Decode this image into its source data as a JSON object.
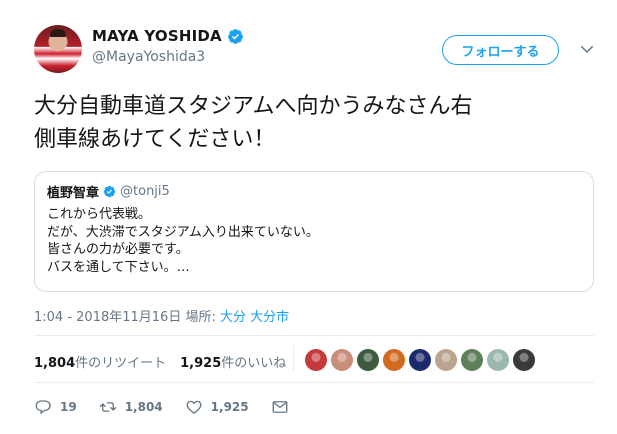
{
  "author": {
    "display_name": "MAYA YOSHIDA",
    "handle": "@MayaYoshida3",
    "verified": true
  },
  "follow_button_label": "フォローする",
  "tweet_text_line1": "大分自動車道スタジアムへ向かうみなさん右",
  "tweet_text_line2": "側車線あけてください！",
  "quoted": {
    "display_name": "植野智章",
    "handle": "@tonji5",
    "lines": [
      "これから代表戦。",
      "だが、大渋滞でスタジアム入り出来ていない。",
      "皆さんの力が必要です。",
      "バスを通して下さい。…"
    ]
  },
  "meta": {
    "time_date": "1:04 - 2018年11月16日",
    "place_label": "場所:",
    "place_value": "大分 大分市"
  },
  "stats": {
    "retweets_count": "1,804",
    "retweets_label": "件のリツイート",
    "likes_count": "1,925",
    "likes_label": "件のいいね"
  },
  "likers": [
    {
      "icon": "liker-avatar-1",
      "color": "#c43a3a"
    },
    {
      "icon": "liker-avatar-2",
      "color": "#c98e7a"
    },
    {
      "icon": "liker-avatar-3",
      "color": "#3d5a3f"
    },
    {
      "icon": "liker-avatar-4",
      "color": "#d26a1f"
    },
    {
      "icon": "liker-avatar-5",
      "color": "#1a2a6b"
    },
    {
      "icon": "liker-avatar-6",
      "color": "#b9a48f"
    },
    {
      "icon": "liker-avatar-7",
      "color": "#5f7e5a"
    },
    {
      "icon": "liker-avatar-8",
      "color": "#9ab7b0"
    },
    {
      "icon": "liker-avatar-9",
      "color": "#3a3a3a"
    }
  ],
  "actions": {
    "reply_count": "19",
    "retweet_count": "1,804",
    "like_count": "1,925"
  },
  "colors": {
    "accent": "#1da1f2",
    "secondary_text": "#657786",
    "primary_text": "#14171a",
    "border": "#e6ecf0"
  }
}
